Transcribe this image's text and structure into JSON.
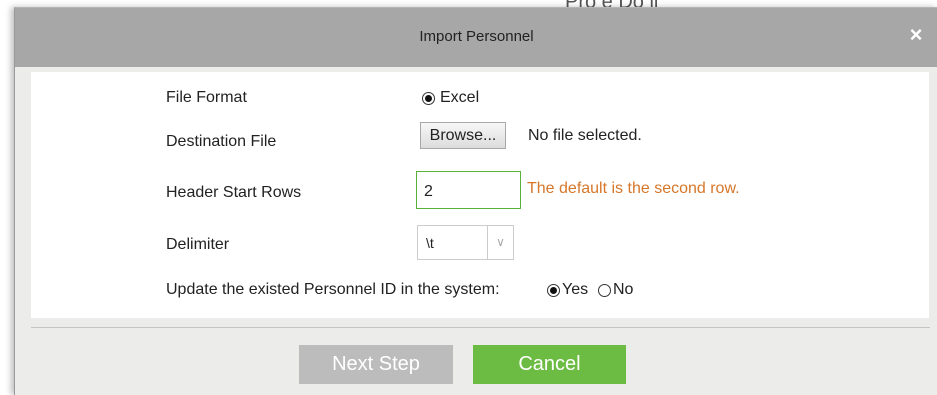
{
  "background": {
    "partial_text": "Pro e Do   ll"
  },
  "dialog": {
    "title": "Import Personnel",
    "close_icon": "×"
  },
  "form": {
    "file_format": {
      "label": "File Format",
      "option": "Excel",
      "selected": true
    },
    "destination_file": {
      "label": "Destination File",
      "browse_label": "Browse...",
      "status": "No file selected."
    },
    "header_start_rows": {
      "label": "Header Start Rows",
      "value": "2",
      "hint": "The default is the second row."
    },
    "delimiter": {
      "label": "Delimiter",
      "value": "\\t"
    },
    "update_existing": {
      "label": "Update the existed Personnel ID in the system:",
      "yes": "Yes",
      "no": "No",
      "selected": "Yes"
    }
  },
  "buttons": {
    "next": "Next Step",
    "cancel": "Cancel"
  },
  "colors": {
    "titlebar": "#a7a7a7",
    "accent_green": "#6cbc43",
    "hint_orange": "#d6772a",
    "disabled_gray": "#bcbcbc"
  }
}
